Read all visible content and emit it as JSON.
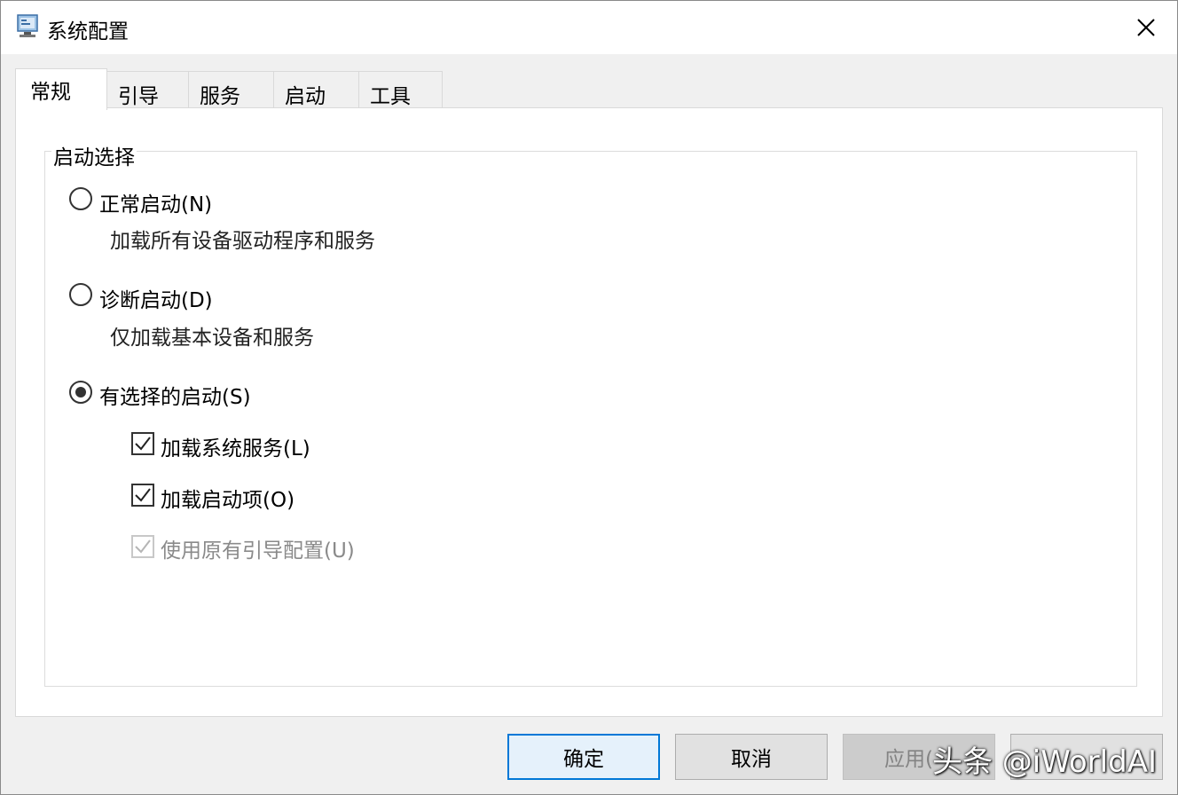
{
  "window": {
    "title": "系统配置"
  },
  "tabs": [
    "常规",
    "引导",
    "服务",
    "启动",
    "工具"
  ],
  "startup_selection": {
    "group_label": "启动选择",
    "normal": {
      "label": "正常启动(N)",
      "description": "加载所有设备驱动程序和服务",
      "selected": false
    },
    "diagnostic": {
      "label": "诊断启动(D)",
      "description": "仅加载基本设备和服务",
      "selected": false
    },
    "selective": {
      "label": "有选择的启动(S)",
      "selected": true
    },
    "options": {
      "load_system_services": {
        "label": "加载系统服务(L)",
        "checked": true,
        "enabled": true
      },
      "load_startup_items": {
        "label": "加载启动项(O)",
        "checked": true,
        "enabled": true
      },
      "use_original_boot_config": {
        "label": "使用原有引导配置(U)",
        "checked": true,
        "enabled": false
      }
    }
  },
  "buttons": {
    "ok": "确定",
    "cancel": "取消",
    "apply": "应用("
  },
  "watermark": "头条 @iWorldAI",
  "colors": {
    "accent": "#0078d7",
    "window_bg": "#f0f0f0",
    "panel_bg": "#ffffff"
  }
}
